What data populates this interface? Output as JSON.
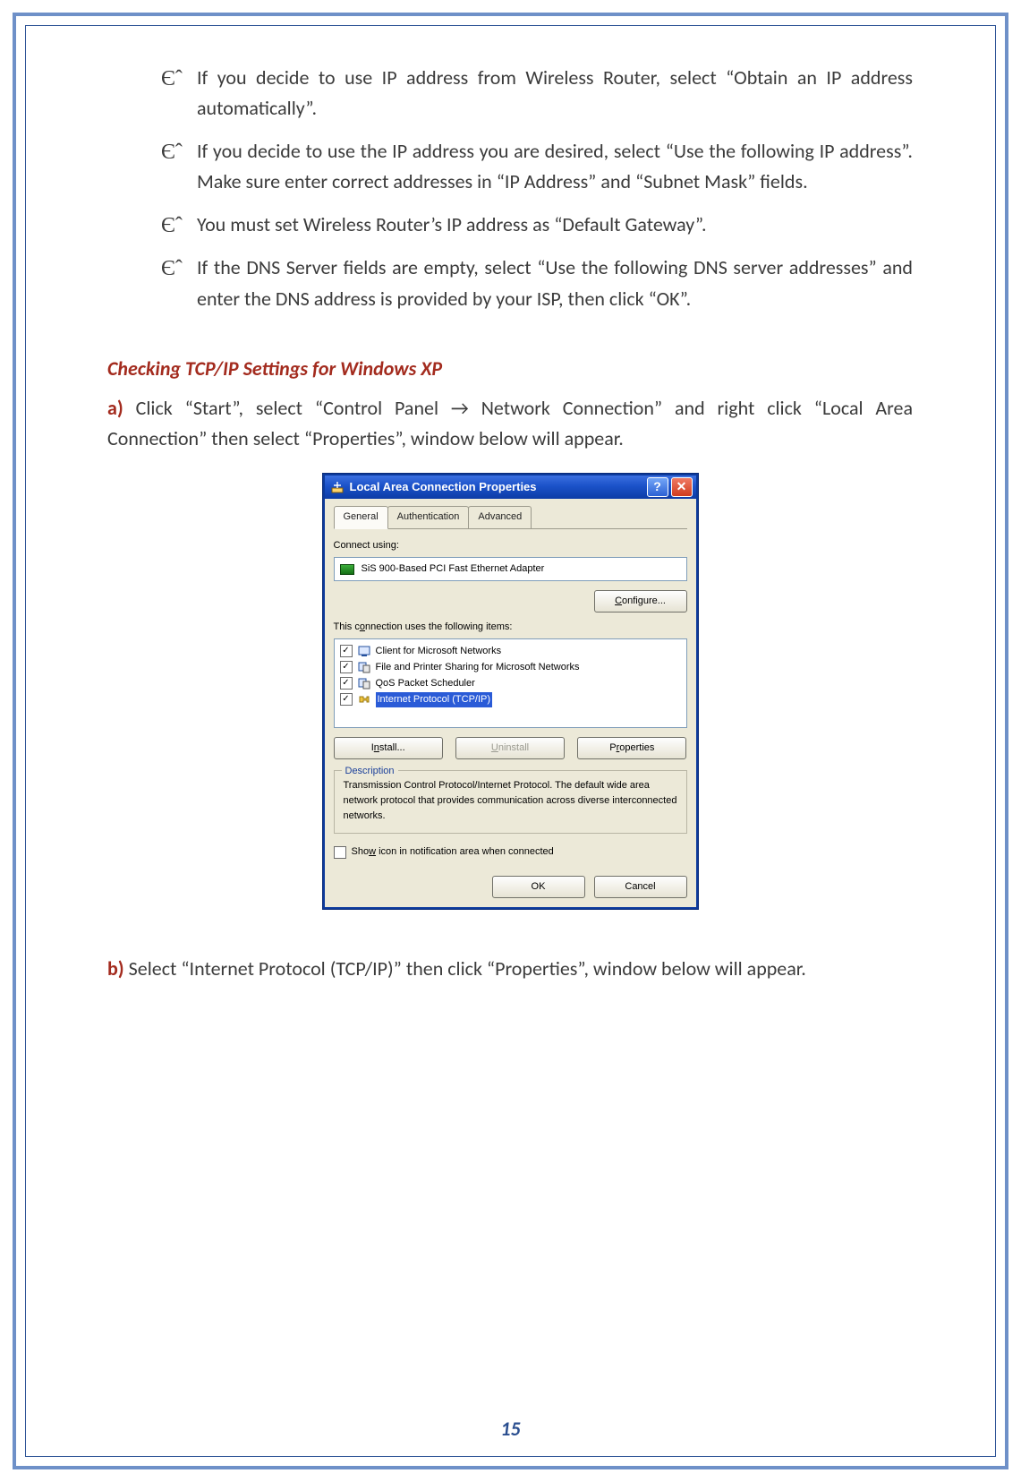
{
  "bullets": [
    "If you decide to use IP address from Wireless Router, select “Obtain an IP address automatically”.",
    "If you decide to use the IP address you are desired, select “Use the following IP address”. Make sure enter correct addresses in “IP Address” and “Subnet Mask” fields.",
    "You must set Wireless Router’s IP address as “Default Gateway”.",
    "If the DNS Server fields are empty, select “Use the following DNS server addresses” and enter the DNS address is provided by your ISP, then click “OK”."
  ],
  "bullet_mark": "Єˆ",
  "section_title": "Checking TCP/IP Settings for Windows XP",
  "para_a_prefix": "a) ",
  "para_a_text": "Click “Start”, select “Control Panel → Network Connection” and right click “Local Area Connection” then select “Properties”, window below will appear.",
  "para_b_prefix": "b) ",
  "para_b_text": "Select “Internet Protocol (TCP/IP)” then click “Properties”, window below will appear.",
  "page_number": "15",
  "xp": {
    "title": "Local Area Connection Properties",
    "help_btn": "?",
    "close_btn": "✕",
    "tabs": {
      "general": "General",
      "auth": "Authentication",
      "adv": "Advanced"
    },
    "connect_using_label": "Connect using:",
    "adapter": "SiS 900-Based PCI Fast Ethernet Adapter",
    "configure_btn": "Configure...",
    "uses_items_label": "This connection uses the following items:",
    "items": [
      {
        "checked": "✓",
        "label": "Client for Microsoft Networks"
      },
      {
        "checked": "✓",
        "label": "File and Printer Sharing for Microsoft Networks"
      },
      {
        "checked": "✓",
        "label": "QoS Packet Scheduler"
      },
      {
        "checked": "✓",
        "label": "Internet Protocol (TCP/IP)"
      }
    ],
    "install_btn": "Install...",
    "uninstall_btn": "Uninstall",
    "properties_btn": "Properties",
    "desc_legend": "Description",
    "desc_text": "Transmission Control Protocol/Internet Protocol. The default wide area network protocol that provides communication across diverse interconnected networks.",
    "show_icon": "Show icon in notification area when connected",
    "ok_btn": "OK",
    "cancel_btn": "Cancel"
  }
}
